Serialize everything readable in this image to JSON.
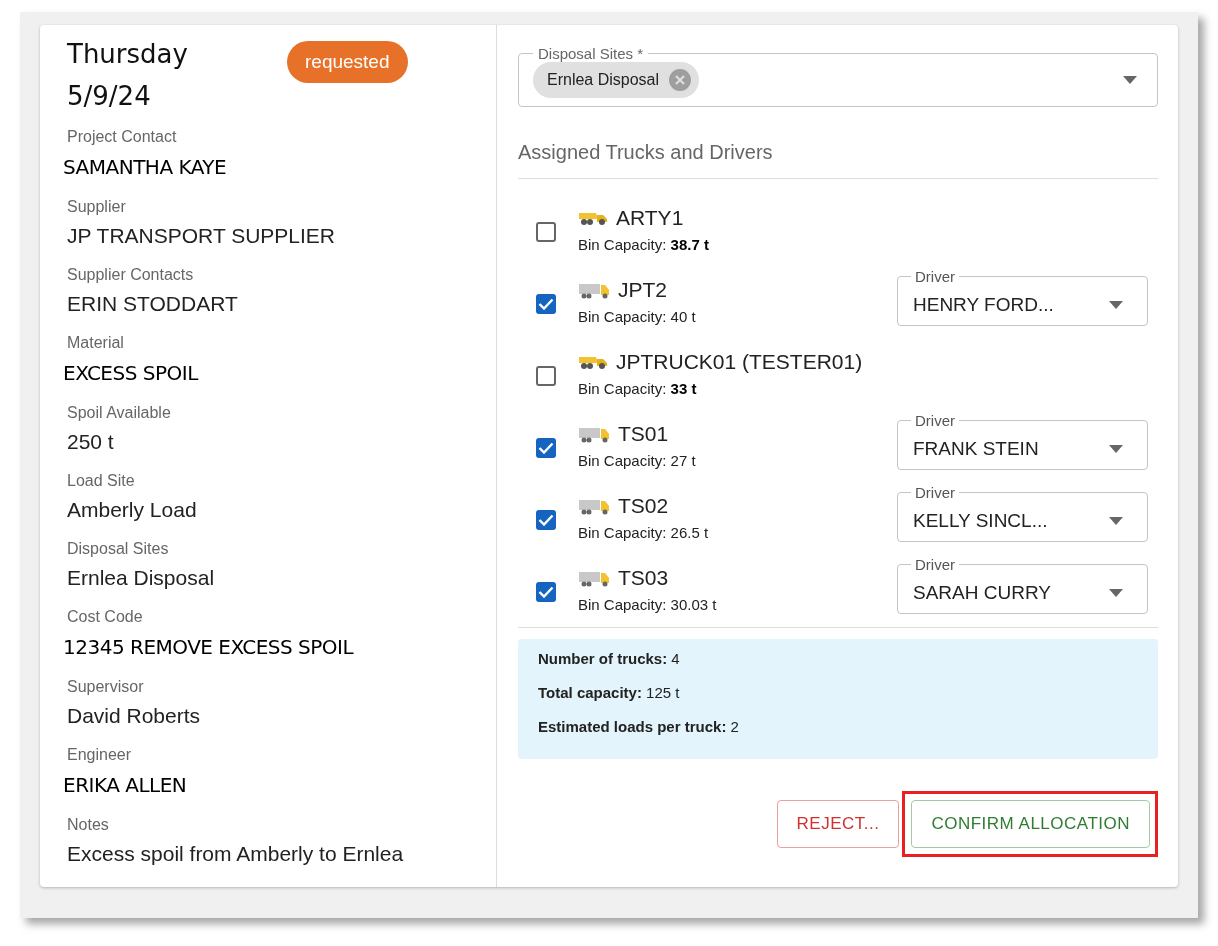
{
  "header": {
    "day": "Thursday",
    "date": "5/9/24",
    "status": "requested"
  },
  "details": [
    {
      "label": "Project Contact",
      "value": "SAMANTHA KAYE",
      "kind": "emphasis"
    },
    {
      "label": "Supplier",
      "value": "JP TRANSPORT SUPPLIER",
      "kind": "plain"
    },
    {
      "label": "Supplier Contacts",
      "value": "ERIN STODDART",
      "kind": "plain"
    },
    {
      "label": "Material",
      "value": "EXCESS SPOIL",
      "kind": "emphasis"
    },
    {
      "label": "Spoil Available",
      "value": "250 t",
      "kind": "plain"
    },
    {
      "label": "Load Site",
      "value": "Amberly Load",
      "kind": "plain"
    },
    {
      "label": "Disposal Sites",
      "value": "Ernlea Disposal",
      "kind": "plain"
    },
    {
      "label": "Cost Code",
      "value": "12345 REMOVE EXCESS SPOIL",
      "kind": "emphasis"
    },
    {
      "label": "Supervisor",
      "value": "David Roberts",
      "kind": "plain"
    },
    {
      "label": "Engineer",
      "value": "ERIKA ALLEN",
      "kind": "emphasis"
    },
    {
      "label": "Notes",
      "value": "Excess spoil from Amberly to Ernlea",
      "kind": "plain"
    }
  ],
  "disposal_sites": {
    "label": "Disposal Sites *",
    "chips": [
      "Ernlea Disposal"
    ]
  },
  "trucks_heading": "Assigned Trucks and Drivers",
  "trucks": [
    {
      "name": "ARTY1",
      "capacity": "Bin Capacity:  **38.7 t**",
      "checked": false,
      "kind": "dump"
    },
    {
      "name": "JPT2",
      "capacity": "Bin Capacity: 40 t",
      "checked": true,
      "kind": "box",
      "driver_label": "Driver",
      "driver": "HENRY FORD..."
    },
    {
      "name": "JPTRUCK01 (TESTER01)",
      "capacity": "Bin Capacity: **33 t**",
      "checked": false,
      "kind": "dump"
    },
    {
      "name": "TS01",
      "capacity": "Bin Capacity: 27 t",
      "checked": true,
      "kind": "box",
      "driver_label": "Driver",
      "driver": "FRANK STEIN"
    },
    {
      "name": "TS02",
      "capacity": "Bin Capacity: 26.5 t",
      "checked": true,
      "kind": "box",
      "driver_label": "Driver",
      "driver": "KELLY SINCL..."
    },
    {
      "name": "TS03",
      "capacity": "Bin Capacity: 30.03 t",
      "checked": true,
      "kind": "box",
      "driver_label": "Driver",
      "driver": "SARAH CURRY"
    }
  ],
  "summary": [
    {
      "label": "Number of trucks:",
      "value": "4"
    },
    {
      "label": "Total capacity:",
      "value": "125 t"
    },
    {
      "label": "Estimated loads per truck:",
      "value": "2"
    }
  ],
  "buttons": {
    "reject": "REJECT...",
    "confirm": "CONFIRM ALLOCATION",
    "confirm_highlighted": true
  }
}
